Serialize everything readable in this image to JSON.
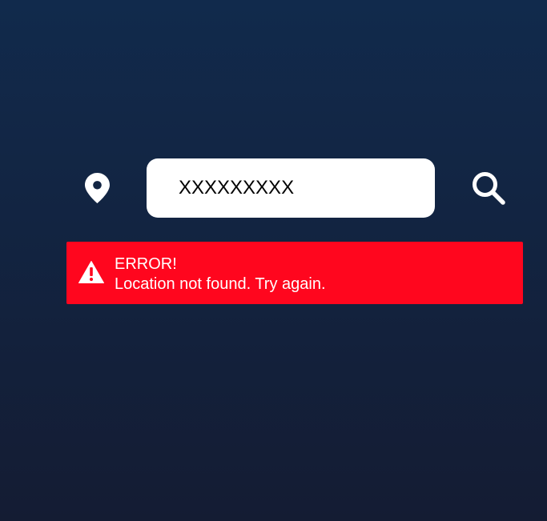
{
  "search": {
    "value": "XXXXXXXXX",
    "icon": "search-icon"
  },
  "location": {
    "icon": "map-pin-icon"
  },
  "error": {
    "icon": "warning-icon",
    "title": "ERROR!",
    "message": "Location not found. Try again.",
    "background_color": "#ff061e"
  },
  "colors": {
    "background_top": "#112a4c",
    "background_bottom": "#141c33"
  }
}
